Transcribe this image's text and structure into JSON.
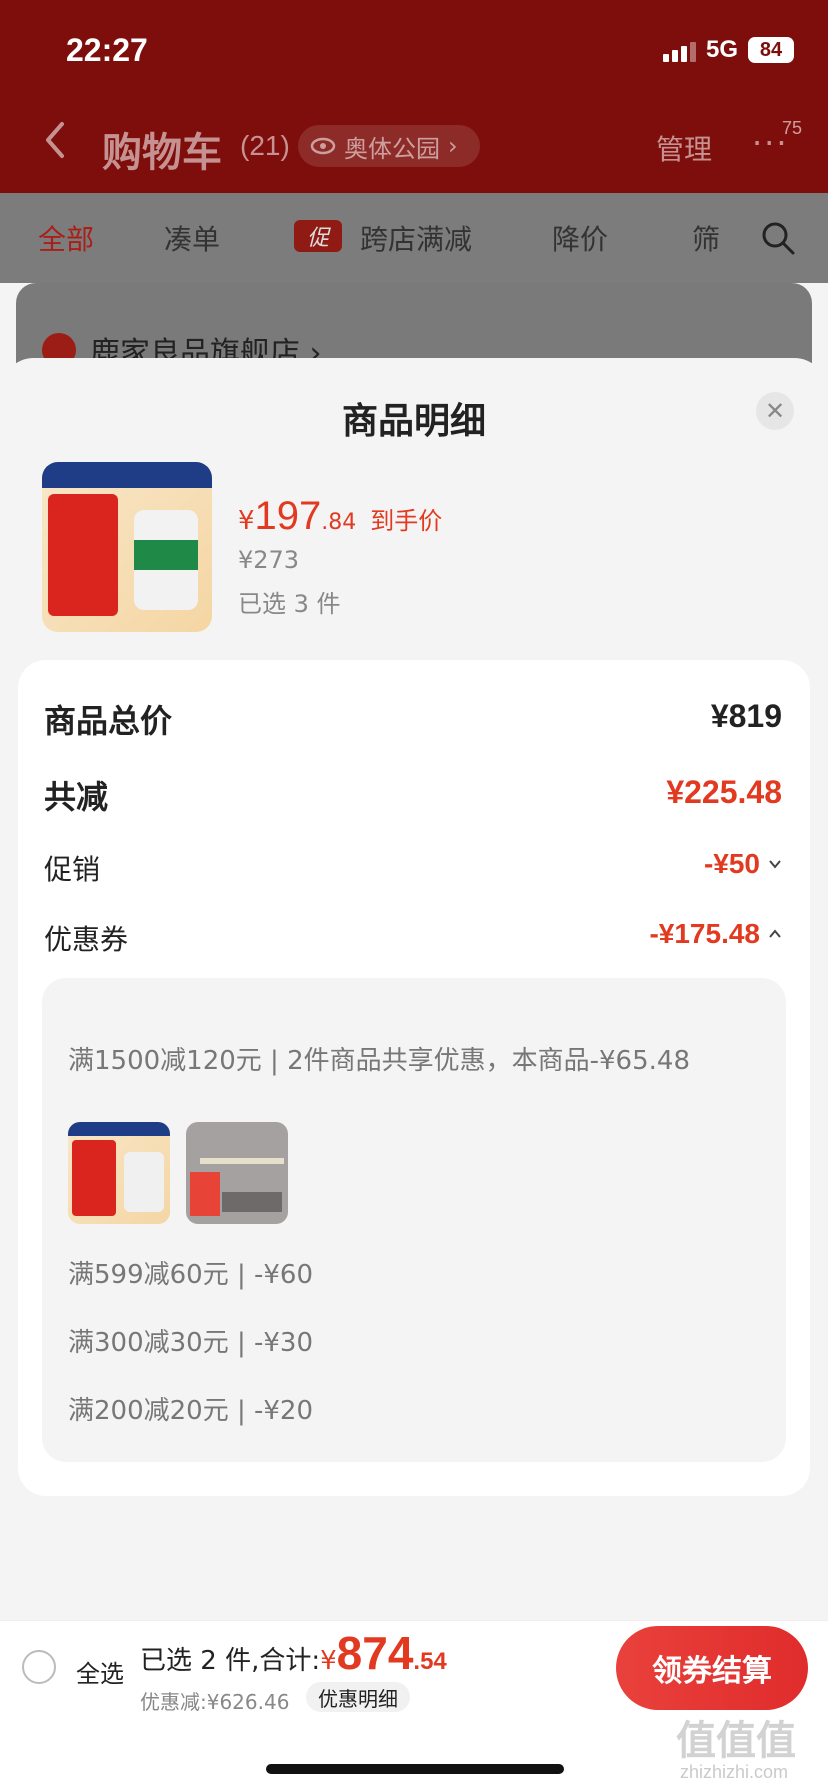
{
  "status_bar": {
    "time": "22:27",
    "network": "5G",
    "battery": "84"
  },
  "header": {
    "title": "购物车",
    "count": "(21)",
    "location": "奥体公园",
    "manage": "管理",
    "more": "···",
    "badge": "75"
  },
  "tabs": [
    {
      "label": "全部"
    },
    {
      "label": "凑单"
    },
    {
      "label": "跨店满减",
      "icon": "促"
    },
    {
      "label": "降价"
    },
    {
      "label": "筛"
    }
  ],
  "shop": {
    "name": "鹿家良品旗舰店 ›"
  },
  "sheet": {
    "title": "商品明细",
    "product": {
      "price_symbol": "¥",
      "price_int": "197",
      "price_dec": ".84",
      "price_tag": "到手价",
      "original_price": "¥273",
      "selected": "已选 3 件"
    },
    "summary": {
      "total_label": "商品总价",
      "total_value": "¥819",
      "reduce_label": "共减",
      "reduce_value": "¥225.48",
      "promo_label": "促销",
      "promo_value": "-¥50",
      "coupon_label": "优惠券",
      "coupon_value": "-¥175.48"
    },
    "coupons": {
      "main": "满1500减120元 | 2件商品共享优惠，本商品-¥65.48",
      "lines": [
        "满599减60元 | -¥60",
        "满300减30元 | -¥30",
        "满200减20元 | -¥20"
      ]
    }
  },
  "bottom": {
    "select_all": "全选",
    "total_label": "已选 2 件,合计:",
    "total_symbol": "¥",
    "total_int": "874",
    "total_dec": ".54",
    "discount": "优惠减:¥626.46",
    "detail": "优惠明细",
    "checkout": "领券结算"
  },
  "watermark": {
    "main": "值值值",
    "sub": "zhizhizhi.com"
  },
  "colors": {
    "accent": "#e23a21",
    "header_bg": "#7e0e0c"
  }
}
